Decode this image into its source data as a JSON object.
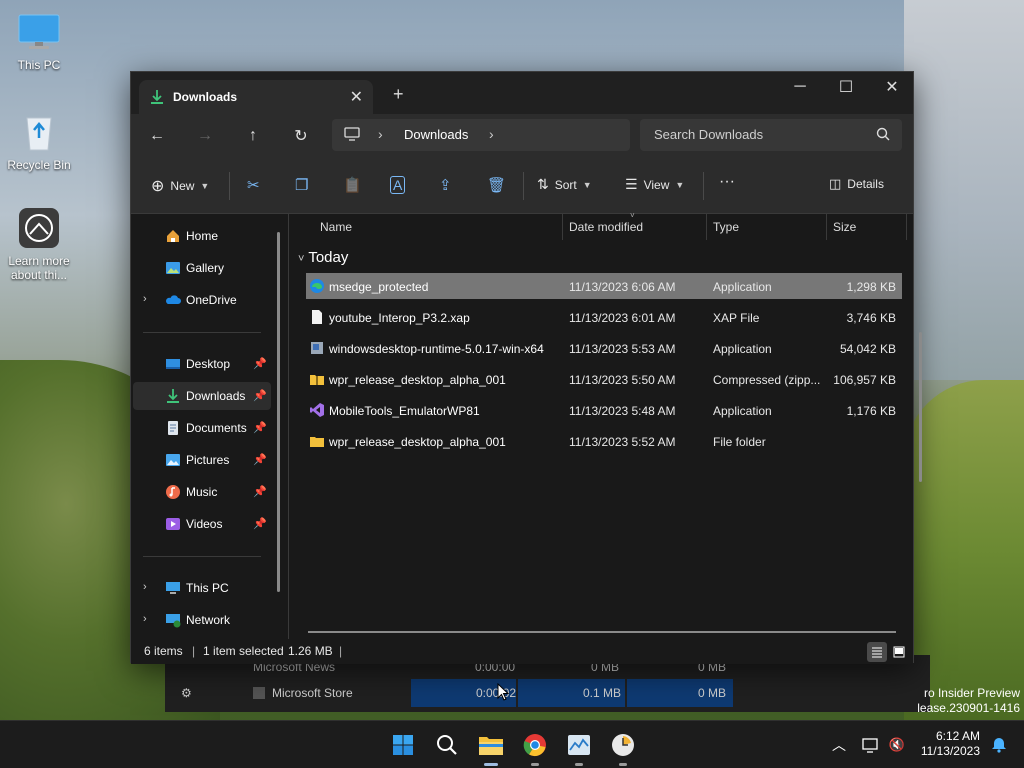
{
  "desktop": {
    "icons": [
      {
        "label": "This PC"
      },
      {
        "label": "Recycle Bin"
      },
      {
        "label": "Learn more about thi..."
      }
    ],
    "watermark": {
      "line1": "ro Insider Preview",
      "line2": "lease.230901-1416"
    }
  },
  "background_app": {
    "rows": [
      {
        "name": "Microsoft News",
        "time": "0:00:00",
        "col2": "0 MB",
        "col3": "0 MB"
      },
      {
        "name": "Microsoft Store",
        "time": "0:00:02",
        "col2": "0.1 MB",
        "col3": "0 MB"
      }
    ]
  },
  "explorer": {
    "tab": {
      "title": "Downloads"
    },
    "window_controls": {
      "minimize": "─",
      "maximize": "☐",
      "close": "✕"
    },
    "address": {
      "crumb": "Downloads",
      "sep": "›"
    },
    "search": {
      "placeholder": "Search Downloads"
    },
    "toolbar": {
      "new": "New",
      "sort": "Sort",
      "view": "View",
      "more": "···",
      "details": "Details"
    },
    "sidebar": {
      "items": [
        {
          "label": "Home"
        },
        {
          "label": "Gallery"
        },
        {
          "label": "OneDrive"
        },
        {
          "label": "Desktop"
        },
        {
          "label": "Downloads"
        },
        {
          "label": "Documents"
        },
        {
          "label": "Pictures"
        },
        {
          "label": "Music"
        },
        {
          "label": "Videos"
        },
        {
          "label": "This PC"
        },
        {
          "label": "Network"
        }
      ]
    },
    "columns": {
      "name": "Name",
      "date": "Date modified",
      "type": "Type",
      "size": "Size"
    },
    "group": "Today",
    "files": [
      {
        "name": "msedge_protected",
        "date": "11/13/2023 6:06 AM",
        "type": "Application",
        "size": "1,298 KB",
        "icon": "edge-icon",
        "selected": true
      },
      {
        "name": "youtube_Interop_P3.2.xap",
        "date": "11/13/2023 6:01 AM",
        "type": "XAP File",
        "size": "3,746 KB",
        "icon": "file-icon"
      },
      {
        "name": "windowsdesktop-runtime-5.0.17-win-x64",
        "date": "11/13/2023 5:53 AM",
        "type": "Application",
        "size": "54,042 KB",
        "icon": "installer-icon"
      },
      {
        "name": "wpr_release_desktop_alpha_001",
        "date": "11/13/2023 5:50 AM",
        "type": "Compressed (zipp...",
        "size": "106,957 KB",
        "icon": "zip-folder-icon"
      },
      {
        "name": "MobileTools_EmulatorWP81",
        "date": "11/13/2023 5:48 AM",
        "type": "Application",
        "size": "1,176 KB",
        "icon": "visual-studio-icon"
      },
      {
        "name": "wpr_release_desktop_alpha_001",
        "date": "11/13/2023 5:52 AM",
        "type": "File folder",
        "size": "",
        "icon": "folder-icon"
      }
    ],
    "status": {
      "items": "6 items",
      "selected": "1 item selected",
      "size": "1.26 MB"
    }
  },
  "taskbar": {
    "clock": {
      "time": "6:12 AM",
      "date": "11/13/2023"
    }
  },
  "colors": {
    "accent": "#0078d4",
    "folder": "#f3c03b",
    "selection": "#777777"
  }
}
